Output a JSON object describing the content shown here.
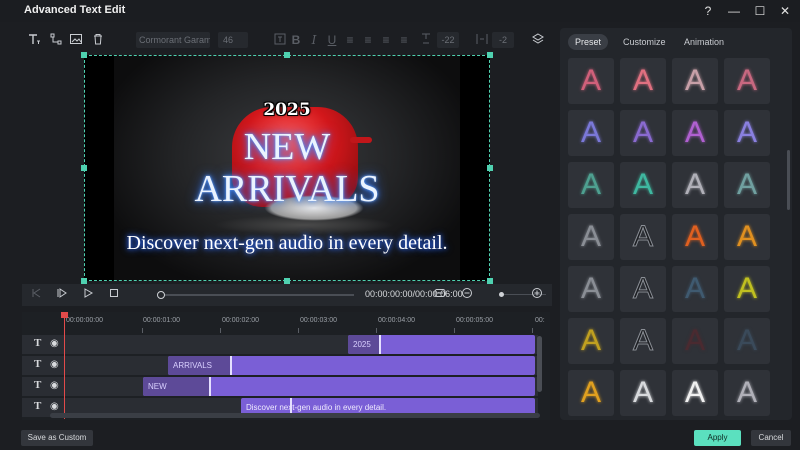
{
  "window": {
    "title": "Advanced Text Edit",
    "controls": {
      "help": "?",
      "minimize": "—",
      "maximize": "☐",
      "close": "✕"
    }
  },
  "toolbar": {
    "font": "Cormorant Garam…",
    "size": "46",
    "letter_spacing": "-22",
    "line_spacing": "-2"
  },
  "preview": {
    "year": "2025",
    "line1": "NEW",
    "line2": "ARRIVALS",
    "subtitle": "Discover next-gen audio in every detail."
  },
  "playback": {
    "timecode": "00:00:00:00/00:00:06:00"
  },
  "timeline": {
    "ruler": [
      "00:00:00:00",
      "00:00:01:00",
      "00:00:02:00",
      "00:00:03:00",
      "00:00:04:00",
      "00:00:05:00",
      "00:"
    ],
    "tracks": [
      {
        "clip": "2025"
      },
      {
        "clip": "ARRIVALS"
      },
      {
        "clip": "NEW"
      },
      {
        "clip": "Discover next-gen audio in every detail."
      }
    ]
  },
  "panel": {
    "tabs": [
      "Preset",
      "Customize",
      "Animation"
    ],
    "active_tab": "Preset",
    "tile_glyph": "A",
    "tile_colors": [
      [
        "#d0607a",
        "#e07080",
        "#c8a0a8",
        "#c86880"
      ],
      [
        "#7a78d8",
        "#8a6ad0",
        "#b060d0",
        "#8a80e0"
      ],
      [
        "#4ea090",
        "#3fb8a0",
        "#b0b0b8",
        "#70a0a0"
      ],
      [
        "#8a8e95",
        "#1c1e22",
        "#e06020",
        "#e09020"
      ],
      [
        "#8a8e95",
        "#1c1e22",
        "#3f5a70",
        "#c0c020"
      ],
      [
        "#c0a020",
        "#1c1e22",
        "#4a2a30",
        "#3a4a5a"
      ],
      [
        "#e0a020",
        "#d8dadd",
        "#f0f0f0",
        "#b0b0b8"
      ]
    ]
  },
  "footer": {
    "save_custom": "Save as Custom",
    "apply": "Apply",
    "cancel": "Cancel"
  },
  "colors": {
    "accent": "#5be0bf",
    "clip": "#7a5fd6",
    "playhead": "#e24a4a"
  }
}
